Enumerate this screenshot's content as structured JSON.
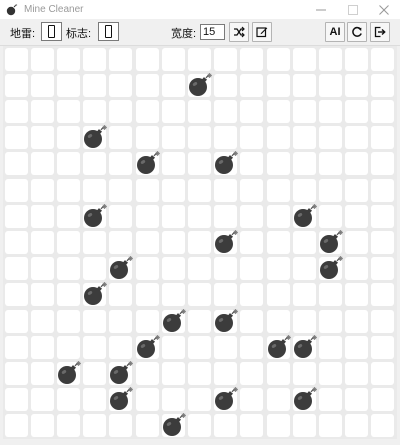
{
  "window": {
    "title": "Mine Cleaner"
  },
  "toolbar": {
    "mines_label": "地雷:",
    "flags_label": "标志:",
    "width_label": "宽度:",
    "width_value": "15",
    "ai_label": "AI"
  },
  "board": {
    "columns": 15,
    "rows": 15,
    "mines": [
      [
        7,
        1
      ],
      [
        3,
        3
      ],
      [
        5,
        4
      ],
      [
        8,
        4
      ],
      [
        3,
        6
      ],
      [
        11,
        6
      ],
      [
        8,
        7
      ],
      [
        12,
        7
      ],
      [
        4,
        8
      ],
      [
        12,
        8
      ],
      [
        3,
        9
      ],
      [
        6,
        10
      ],
      [
        8,
        10
      ],
      [
        5,
        11
      ],
      [
        10,
        11
      ],
      [
        11,
        11
      ],
      [
        2,
        12
      ],
      [
        4,
        12
      ],
      [
        4,
        13
      ],
      [
        8,
        13
      ],
      [
        11,
        13
      ],
      [
        6,
        14
      ]
    ]
  },
  "icons": {
    "app": "bomb-icon",
    "shuffle": "shuffle-icon",
    "edit": "edit-icon",
    "restart": "restart-icon",
    "exit": "exit-icon",
    "mine": "bomb-icon"
  }
}
